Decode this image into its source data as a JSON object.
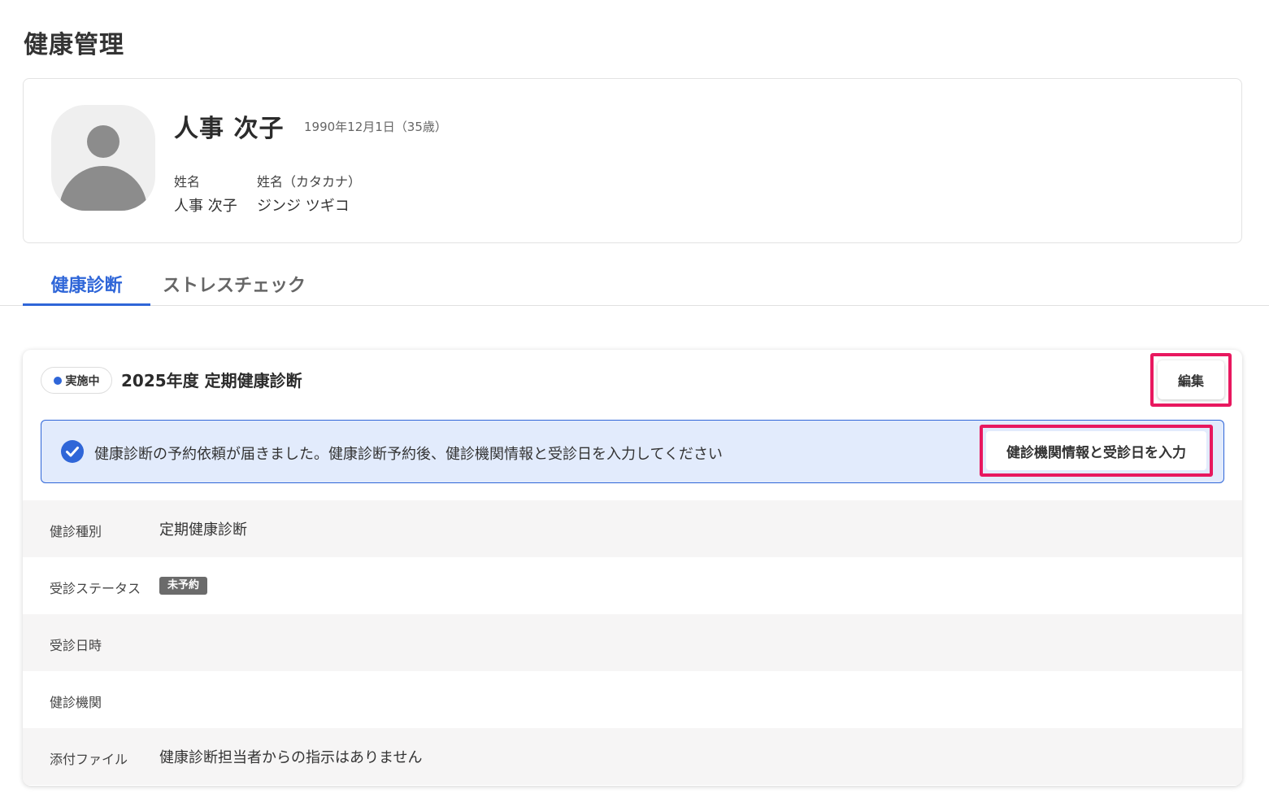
{
  "page": {
    "title": "健康管理"
  },
  "profile": {
    "name": "人事 次子",
    "birth": "1990年12月1日（35歳）",
    "fields": [
      {
        "label": "姓名",
        "value": "人事 次子"
      },
      {
        "label": "姓名（カタカナ）",
        "value": "ジンジ ツギコ"
      }
    ]
  },
  "tabs": [
    {
      "label": "健康診断",
      "active": true
    },
    {
      "label": "ストレスチェック",
      "active": false
    }
  ],
  "exam": {
    "status": "実施中",
    "title": "2025年度 定期健康診断",
    "edit_label": "編集",
    "notice": {
      "text": "健康診断の予約依頼が届きました。健康診断予約後、健診機関情報と受診日を入力してください",
      "button_label": "健診機関情報と受診日を入力"
    },
    "details": [
      {
        "label": "健診種別",
        "value": "定期健康診断"
      },
      {
        "label": "受診ステータス",
        "tag": "未予約"
      },
      {
        "label": "受診日時",
        "value": ""
      },
      {
        "label": "健診機関",
        "value": ""
      },
      {
        "label": "添付ファイル",
        "value": "健康診断担当者からの指示はありません"
      }
    ]
  },
  "colors": {
    "accent": "#2f66d8",
    "highlight": "#e8185f",
    "notice_bg": "#e2ebfc",
    "tag_bg": "#6b6b6b"
  }
}
